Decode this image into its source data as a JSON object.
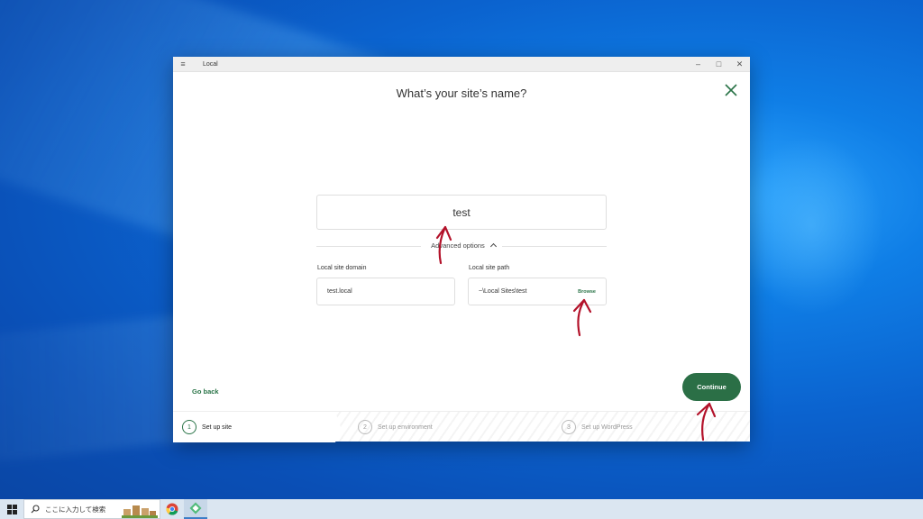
{
  "window": {
    "title": "Local",
    "menu_icon": "hamburger-icon",
    "controls": {
      "minimize": "–",
      "maximize": "□",
      "close": "✕"
    }
  },
  "dialog": {
    "heading": "What’s your site’s name?",
    "site_name_value": "test",
    "advanced_options_label": "Advanced options",
    "domain_label": "Local site domain",
    "domain_value": "test.local",
    "path_label": "Local site path",
    "path_value": "~\\Local Sites\\test",
    "browse_label": "Browse",
    "go_back_label": "Go back",
    "continue_label": "Continue"
  },
  "steps": [
    {
      "num": "1",
      "label": "Set up site",
      "active": true
    },
    {
      "num": "2",
      "label": "Set up environment",
      "active": false
    },
    {
      "num": "3",
      "label": "Set up WordPress",
      "active": false
    }
  ],
  "taskbar": {
    "search_placeholder": "ここに入力して検索",
    "apps": [
      "chrome-icon",
      "local-app-icon"
    ]
  },
  "colors": {
    "brand_green": "#2b6f46",
    "annotation_arrow": "#b3122a"
  }
}
